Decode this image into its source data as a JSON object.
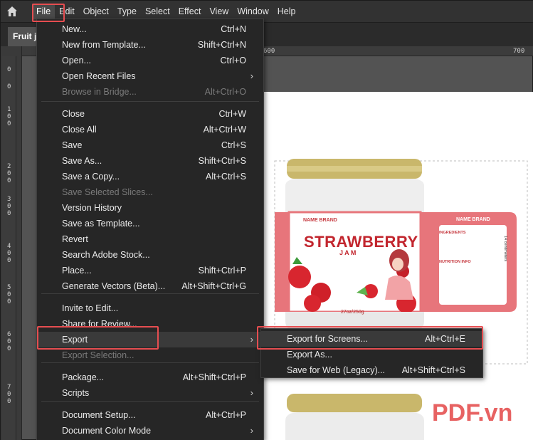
{
  "menubar": {
    "items": [
      "File",
      "Edit",
      "Object",
      "Type",
      "Select",
      "Effect",
      "View",
      "Window",
      "Help"
    ]
  },
  "tab": {
    "title": "Fruit ja"
  },
  "ruler": {
    "top": [
      "600",
      "700"
    ],
    "left": [
      "0",
      "0",
      "1 0 0",
      "2 0 0",
      "3 0 0",
      "4 0 0",
      "5 0 0",
      "6 0 0",
      "7 0 0"
    ]
  },
  "file_menu": [
    {
      "label": "New...",
      "shortcut": "Ctrl+N"
    },
    {
      "label": "New from Template...",
      "shortcut": "Shift+Ctrl+N"
    },
    {
      "label": "Open...",
      "shortcut": "Ctrl+O"
    },
    {
      "label": "Open Recent Files",
      "shortcut": "",
      "submenu": true
    },
    {
      "label": "Browse in Bridge...",
      "shortcut": "Alt+Ctrl+O",
      "disabled": true
    },
    {
      "label": "Close",
      "shortcut": "Ctrl+W"
    },
    {
      "label": "Close All",
      "shortcut": "Alt+Ctrl+W"
    },
    {
      "label": "Save",
      "shortcut": "Ctrl+S"
    },
    {
      "label": "Save As...",
      "shortcut": "Shift+Ctrl+S"
    },
    {
      "label": "Save a Copy...",
      "shortcut": "Alt+Ctrl+S"
    },
    {
      "label": "Save Selected Slices...",
      "shortcut": "",
      "disabled": true
    },
    {
      "label": "Version History",
      "shortcut": ""
    },
    {
      "label": "Save as Template...",
      "shortcut": ""
    },
    {
      "label": "Revert",
      "shortcut": ""
    },
    {
      "label": "Search Adobe Stock...",
      "shortcut": ""
    },
    {
      "label": "Place...",
      "shortcut": "Shift+Ctrl+P"
    },
    {
      "label": "Generate Vectors (Beta)...",
      "shortcut": "Alt+Shift+Ctrl+G"
    },
    {
      "label": "Invite to Edit...",
      "shortcut": ""
    },
    {
      "label": "Share for Review...",
      "shortcut": ""
    },
    {
      "label": "Export",
      "shortcut": "",
      "submenu": true,
      "highlighted": true
    },
    {
      "label": "Export Selection...",
      "shortcut": "",
      "disabled": true
    },
    {
      "label": "Package...",
      "shortcut": "Alt+Shift+Ctrl+P"
    },
    {
      "label": "Scripts",
      "shortcut": "",
      "submenu": true
    },
    {
      "label": "Document Setup...",
      "shortcut": "Alt+Ctrl+P"
    },
    {
      "label": "Document Color Mode",
      "shortcut": "",
      "submenu": true
    }
  ],
  "export_submenu": [
    {
      "label": "Export for Screens...",
      "shortcut": "Alt+Ctrl+E",
      "highlighted": true
    },
    {
      "label": "Export As...",
      "shortcut": ""
    },
    {
      "label": "Save for Web (Legacy)...",
      "shortcut": "Alt+Shift+Ctrl+S"
    }
  ],
  "artwork": {
    "brand": "NAME BRAND",
    "product": "STRAWBERRY",
    "subtitle": "J A M",
    "weight": "27oz/250g",
    "side_title": "NAME BRAND",
    "ingredients_heading": "INGREDIENTS",
    "nutrition_heading": "NUTRITION INFO",
    "size_note": "14 centimeters"
  },
  "watermark": "PDF.vn",
  "colors": {
    "highlight": "#e64d50",
    "menu_bg": "#262626",
    "label_pink": "#e7757b",
    "watermark": "#e34747"
  }
}
